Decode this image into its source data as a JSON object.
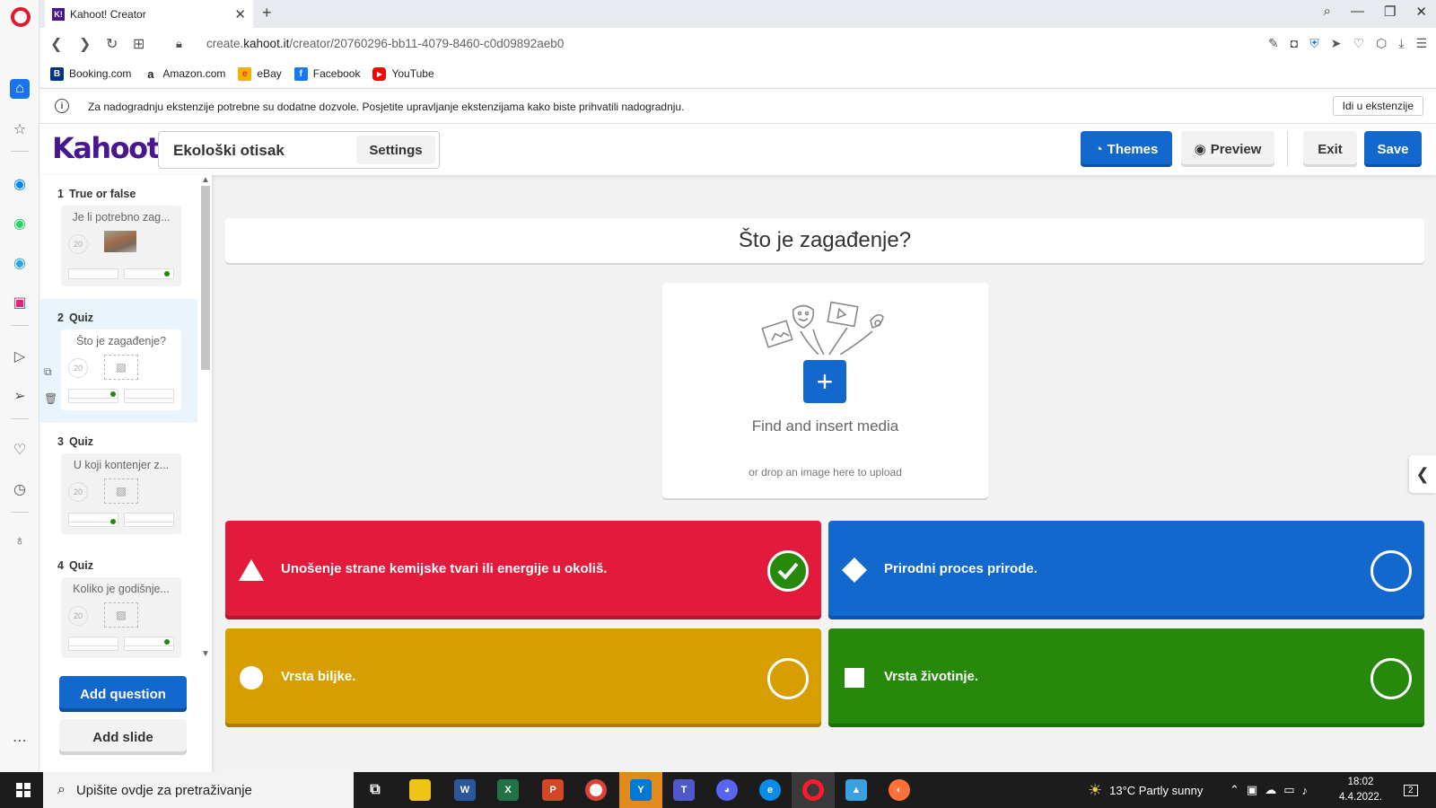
{
  "browser": {
    "tab_title": "Kahoot! Creator",
    "tab_favicon": "K!",
    "url_prefix": "create.",
    "url_domain": "kahoot.it",
    "url_path": "/creator/20760296-bb11-4079-8460-c0d09892aeb0",
    "bookmarks": [
      {
        "label": "Booking.com",
        "icon": "B",
        "color": "#003580"
      },
      {
        "label": "Amazon.com",
        "icon": "a",
        "color": "#222222"
      },
      {
        "label": "eBay",
        "icon": "e",
        "color": "#e53238"
      },
      {
        "label": "Facebook",
        "icon": "f",
        "color": "#1877f2"
      },
      {
        "label": "YouTube",
        "icon": "▶",
        "color": "#ff0000"
      }
    ],
    "notice_text": "Za nadogradnju ekstenzije potrebne su dodatne dozvole. Posjetite upravljanje ekstenzijama kako biste prihvatili nadogradnju.",
    "notice_button": "Idi u ekstenzije"
  },
  "header": {
    "logo": "Kahoot!",
    "title": "Ekološki otisak",
    "settings": "Settings",
    "themes": "Themes",
    "preview": "Preview",
    "exit": "Exit",
    "save": "Save"
  },
  "slides": [
    {
      "num": "1",
      "type": "True or false",
      "text": "Je li potrebno zag...",
      "timer": "20"
    },
    {
      "num": "2",
      "type": "Quiz",
      "text": "Što je zagađenje?",
      "timer": "20"
    },
    {
      "num": "3",
      "type": "Quiz",
      "text": "U koji kontenjer z...",
      "timer": "20"
    },
    {
      "num": "4",
      "type": "Quiz",
      "text": "Koliko je godišnje...",
      "timer": "20"
    }
  ],
  "sidebar_buttons": {
    "add_question": "Add question",
    "add_slide": "Add slide"
  },
  "editor": {
    "question": "Što je zagađenje?",
    "media_title": "Find and insert media",
    "media_sub": "or drop an image here to upload",
    "answers": [
      {
        "text": "Unošenje strane kemijske tvari ili energije u okoliš.",
        "color": "#e21b3c",
        "shape": "triangle",
        "correct": true
      },
      {
        "text": "Prirodni proces prirode.",
        "color": "#1368ce",
        "shape": "diamond",
        "correct": false
      },
      {
        "text": "Vrsta biljke.",
        "color": "#d89e00",
        "shape": "circle",
        "correct": false
      },
      {
        "text": "Vrsta životinje.",
        "color": "#26890c",
        "shape": "square",
        "correct": false
      }
    ]
  },
  "taskbar": {
    "search_placeholder": "Upišite ovdje za pretraživanje",
    "weather": "13°C  Partly sunny",
    "time": "18:02",
    "date": "4.4.2022.",
    "notifications": "2"
  }
}
